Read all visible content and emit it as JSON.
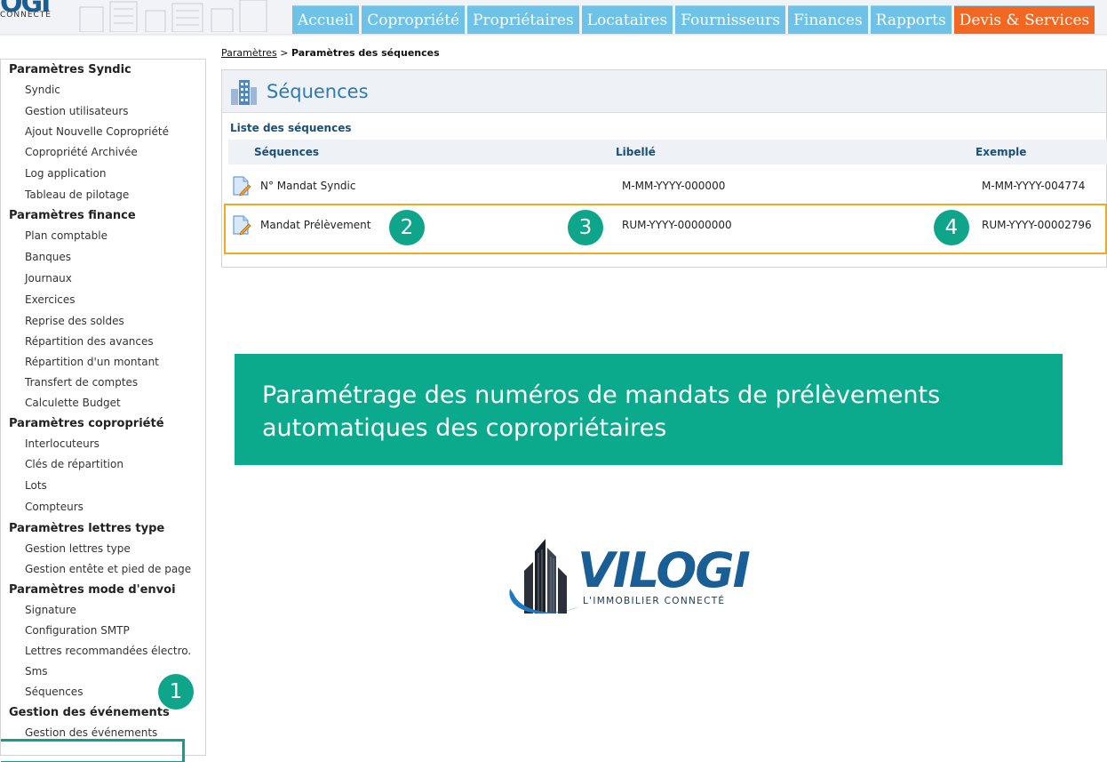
{
  "header": {
    "logo_text": "OGI",
    "logo_sub": "CONNECTÉ",
    "tabs": [
      {
        "label": "Accueil"
      },
      {
        "label": "Copropriété"
      },
      {
        "label": "Propriétaires"
      },
      {
        "label": "Locataires"
      },
      {
        "label": "Fournisseurs"
      },
      {
        "label": "Finances"
      },
      {
        "label": "Rapports"
      },
      {
        "label": "Devis & Services"
      }
    ],
    "tab_color": "#6ec2e8",
    "highlight_tab_color": "#f26722"
  },
  "sidebar": {
    "groups": [
      {
        "title": "Paramètres Syndic",
        "items": [
          "Syndic",
          "Gestion utilisateurs",
          "Ajout Nouvelle Copropriété",
          "Copropriété Archivée",
          "Log application",
          "Tableau de pilotage"
        ]
      },
      {
        "title": "Paramètres finance",
        "items": [
          "Plan comptable",
          "Banques",
          "Journaux",
          "Exercices",
          "Reprise des soldes",
          "Répartition des avances",
          "Répartition d'un montant",
          "Transfert de comptes",
          "Calculette Budget"
        ]
      },
      {
        "title": "Paramètres copropriété",
        "items": [
          "Interlocuteurs",
          "Clés de répartition",
          "Lots",
          "Compteurs"
        ]
      },
      {
        "title": "Paramètres lettres type",
        "items": [
          "Gestion lettres type",
          "Gestion entête et pied de page"
        ]
      },
      {
        "title": "Paramètres mode d'envoi",
        "items": [
          "Signature",
          "Configuration SMTP",
          "Lettres recommandées électro.",
          "Sms",
          "Séquences"
        ]
      },
      {
        "title": "Gestion des événements",
        "items": [
          "Gestion des événements"
        ]
      }
    ],
    "active_item": "Séquences"
  },
  "breadcrumb": {
    "parent": "Paramètres",
    "separator": " > ",
    "current": "Paramètres des séquences"
  },
  "panel": {
    "title": "Séquences",
    "list_title": "Liste des séquences",
    "columns": [
      "Séquences",
      "Libellé",
      "Exemple"
    ],
    "rows": [
      {
        "sequence": "N° Mandat Syndic",
        "libelle": "M-MM-YYYY-000000",
        "exemple": "M-MM-YYYY-004774"
      },
      {
        "sequence": "Mandat Prélèvement",
        "libelle": "RUM-YYYY-00000000",
        "exemple": "RUM-YYYY-00002796"
      }
    ]
  },
  "badges": [
    "1",
    "2",
    "3",
    "4"
  ],
  "badge_color": "#0ea58a",
  "highlight_color": "#f2a91f",
  "banner": {
    "line1": "Paramétrage des numéros de mandats de prélèvements",
    "line2": "automatiques des copropriétaires",
    "color": "#0baa8d"
  },
  "brand": {
    "name": "VILOGI",
    "tagline": "L'IMMOBILIER CONNECTÉ"
  }
}
